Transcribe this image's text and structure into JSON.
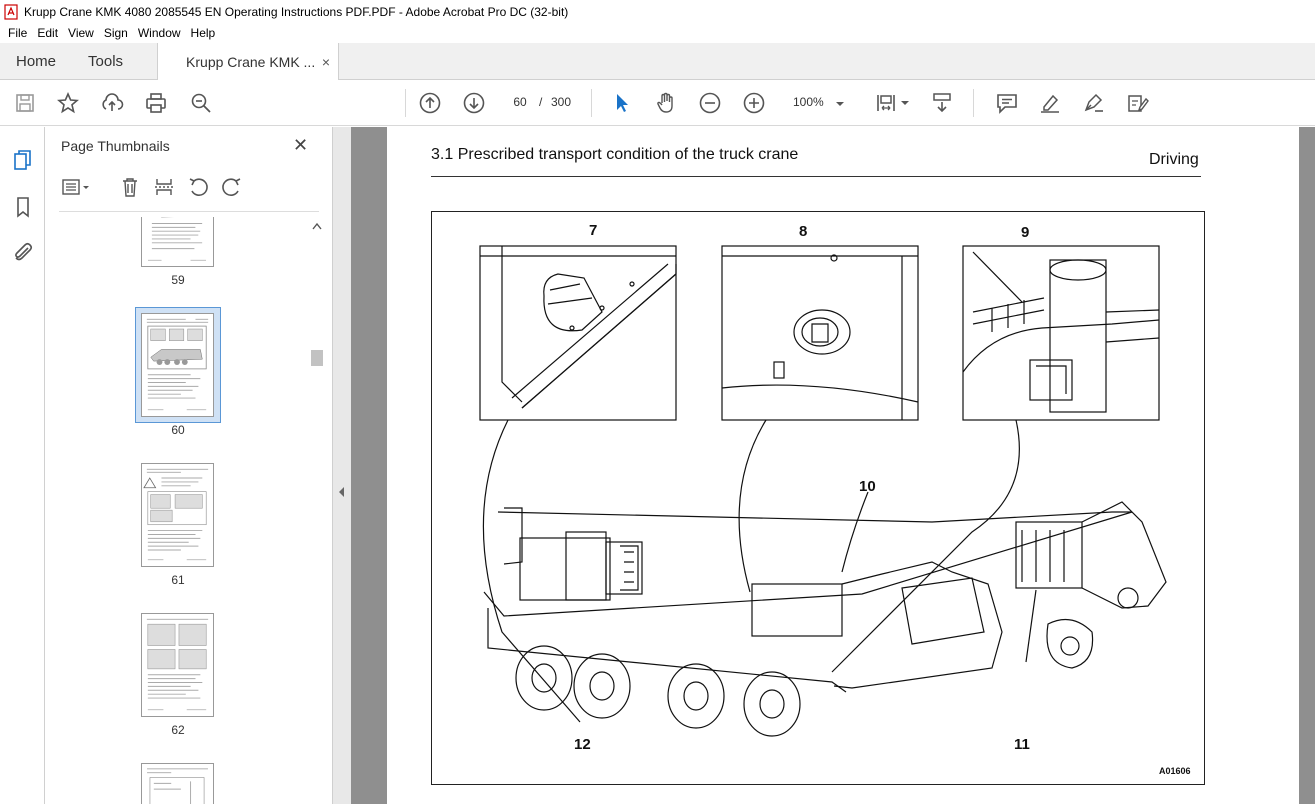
{
  "window": {
    "title": "Krupp Crane KMK 4080 2085545 EN Operating Instructions PDF.PDF - Adobe Acrobat Pro DC (32-bit)"
  },
  "menu": [
    "File",
    "Edit",
    "View",
    "Sign",
    "Window",
    "Help"
  ],
  "tabs": {
    "home": "Home",
    "tools": "Tools",
    "document": "Krupp Crane KMK ...",
    "close_glyph": "×"
  },
  "toolbar": {
    "current_page": "60",
    "separator": "/",
    "total_pages": "300",
    "zoom": "100%",
    "icons": [
      "save-icon",
      "bookmark-star-icon",
      "upload-icon",
      "print-icon",
      "find-zoom-icon",
      "page-up-icon",
      "page-down-icon",
      "select-cursor-icon",
      "hand-icon",
      "zoom-out-icon",
      "zoom-in-icon",
      "zoom-dropdown-icon",
      "fit-page-icon",
      "scroll-mode-icon",
      "comment-icon",
      "highlight-icon",
      "sign-icon",
      "fill-sign-icon"
    ]
  },
  "panel": {
    "title": "Page Thumbnails",
    "close_glyph": "✕",
    "thumbnails": [
      {
        "label": "59"
      },
      {
        "label": "60",
        "selected": true
      },
      {
        "label": "61"
      },
      {
        "label": "62"
      },
      {
        "label": ""
      }
    ]
  },
  "document": {
    "header_left": "3.1 Prescribed transport condition of the truck crane",
    "header_right": "Driving",
    "callouts": [
      "7",
      "8",
      "9",
      "10",
      "11",
      "12"
    ],
    "figure_id": "A01606"
  },
  "colors": {
    "accent_blue": "#1a73c8",
    "doc_bg": "#8f8f8f",
    "selection": "#cfe1f5"
  }
}
